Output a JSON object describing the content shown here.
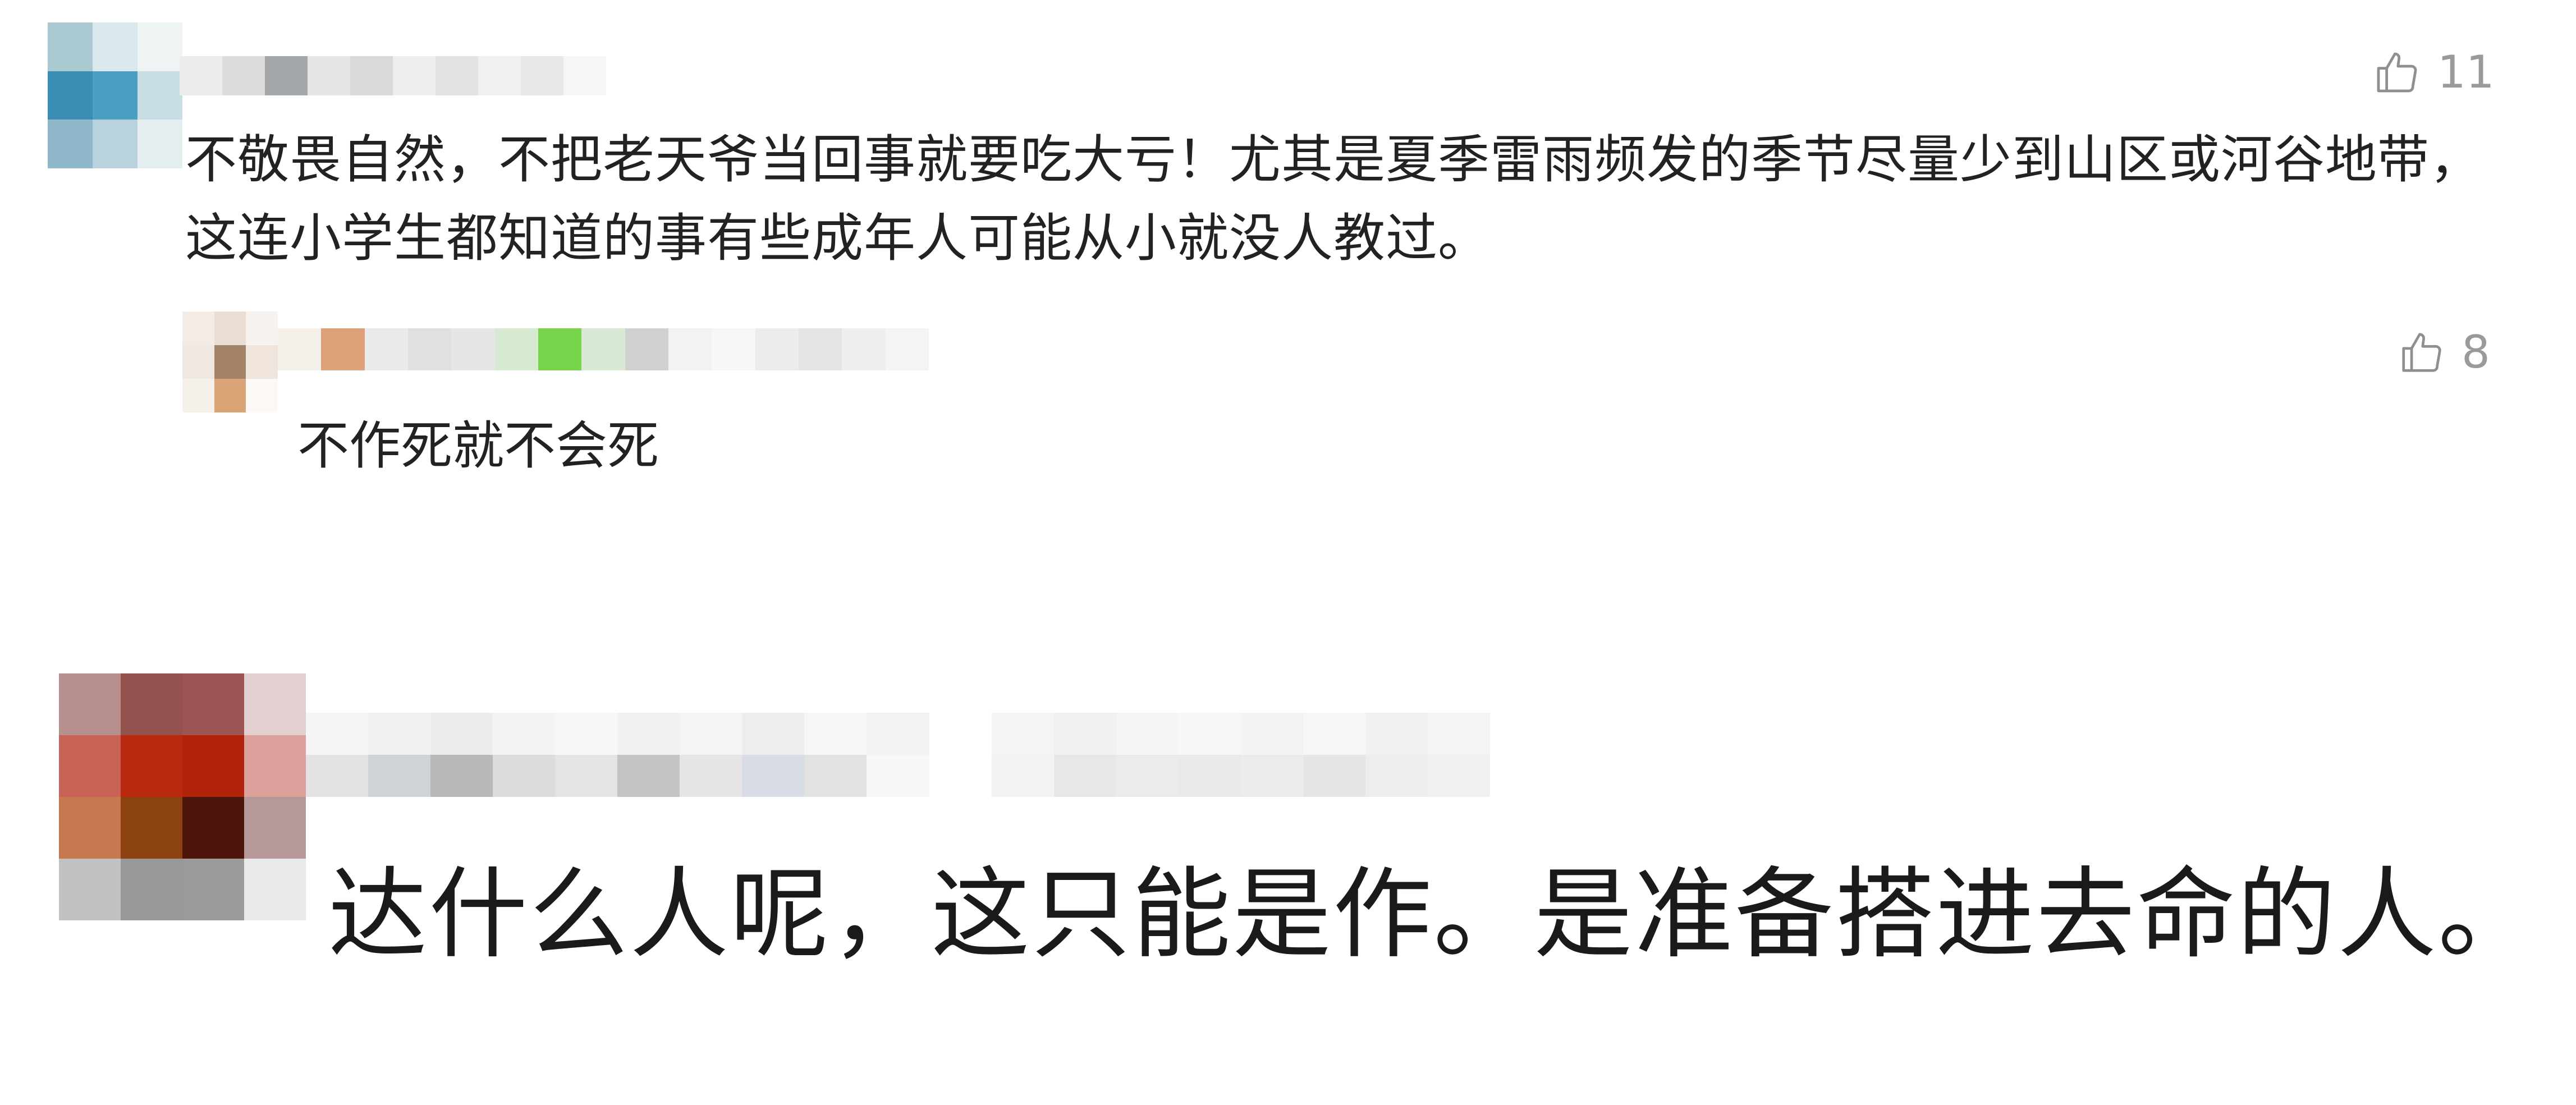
{
  "comments": [
    {
      "text": "不敬畏自然，不把老天爷当回事就要吃大亏！尤其是夏季雷雨频发的季节尽量少到山区或河谷地带，这连小学生都知道的事有些成年人可能从小就没人教过。",
      "likes": "11",
      "icon": "thumbs-up-icon",
      "reply": {
        "text": "不作死就不会死",
        "likes": "8",
        "icon": "thumbs-up-icon"
      }
    },
    {
      "text": "达什么人呢，这只能是作。是准备搭进去命的人。"
    }
  ],
  "colors": {
    "text": "#222222",
    "like_gray": "#9a9a9a"
  }
}
